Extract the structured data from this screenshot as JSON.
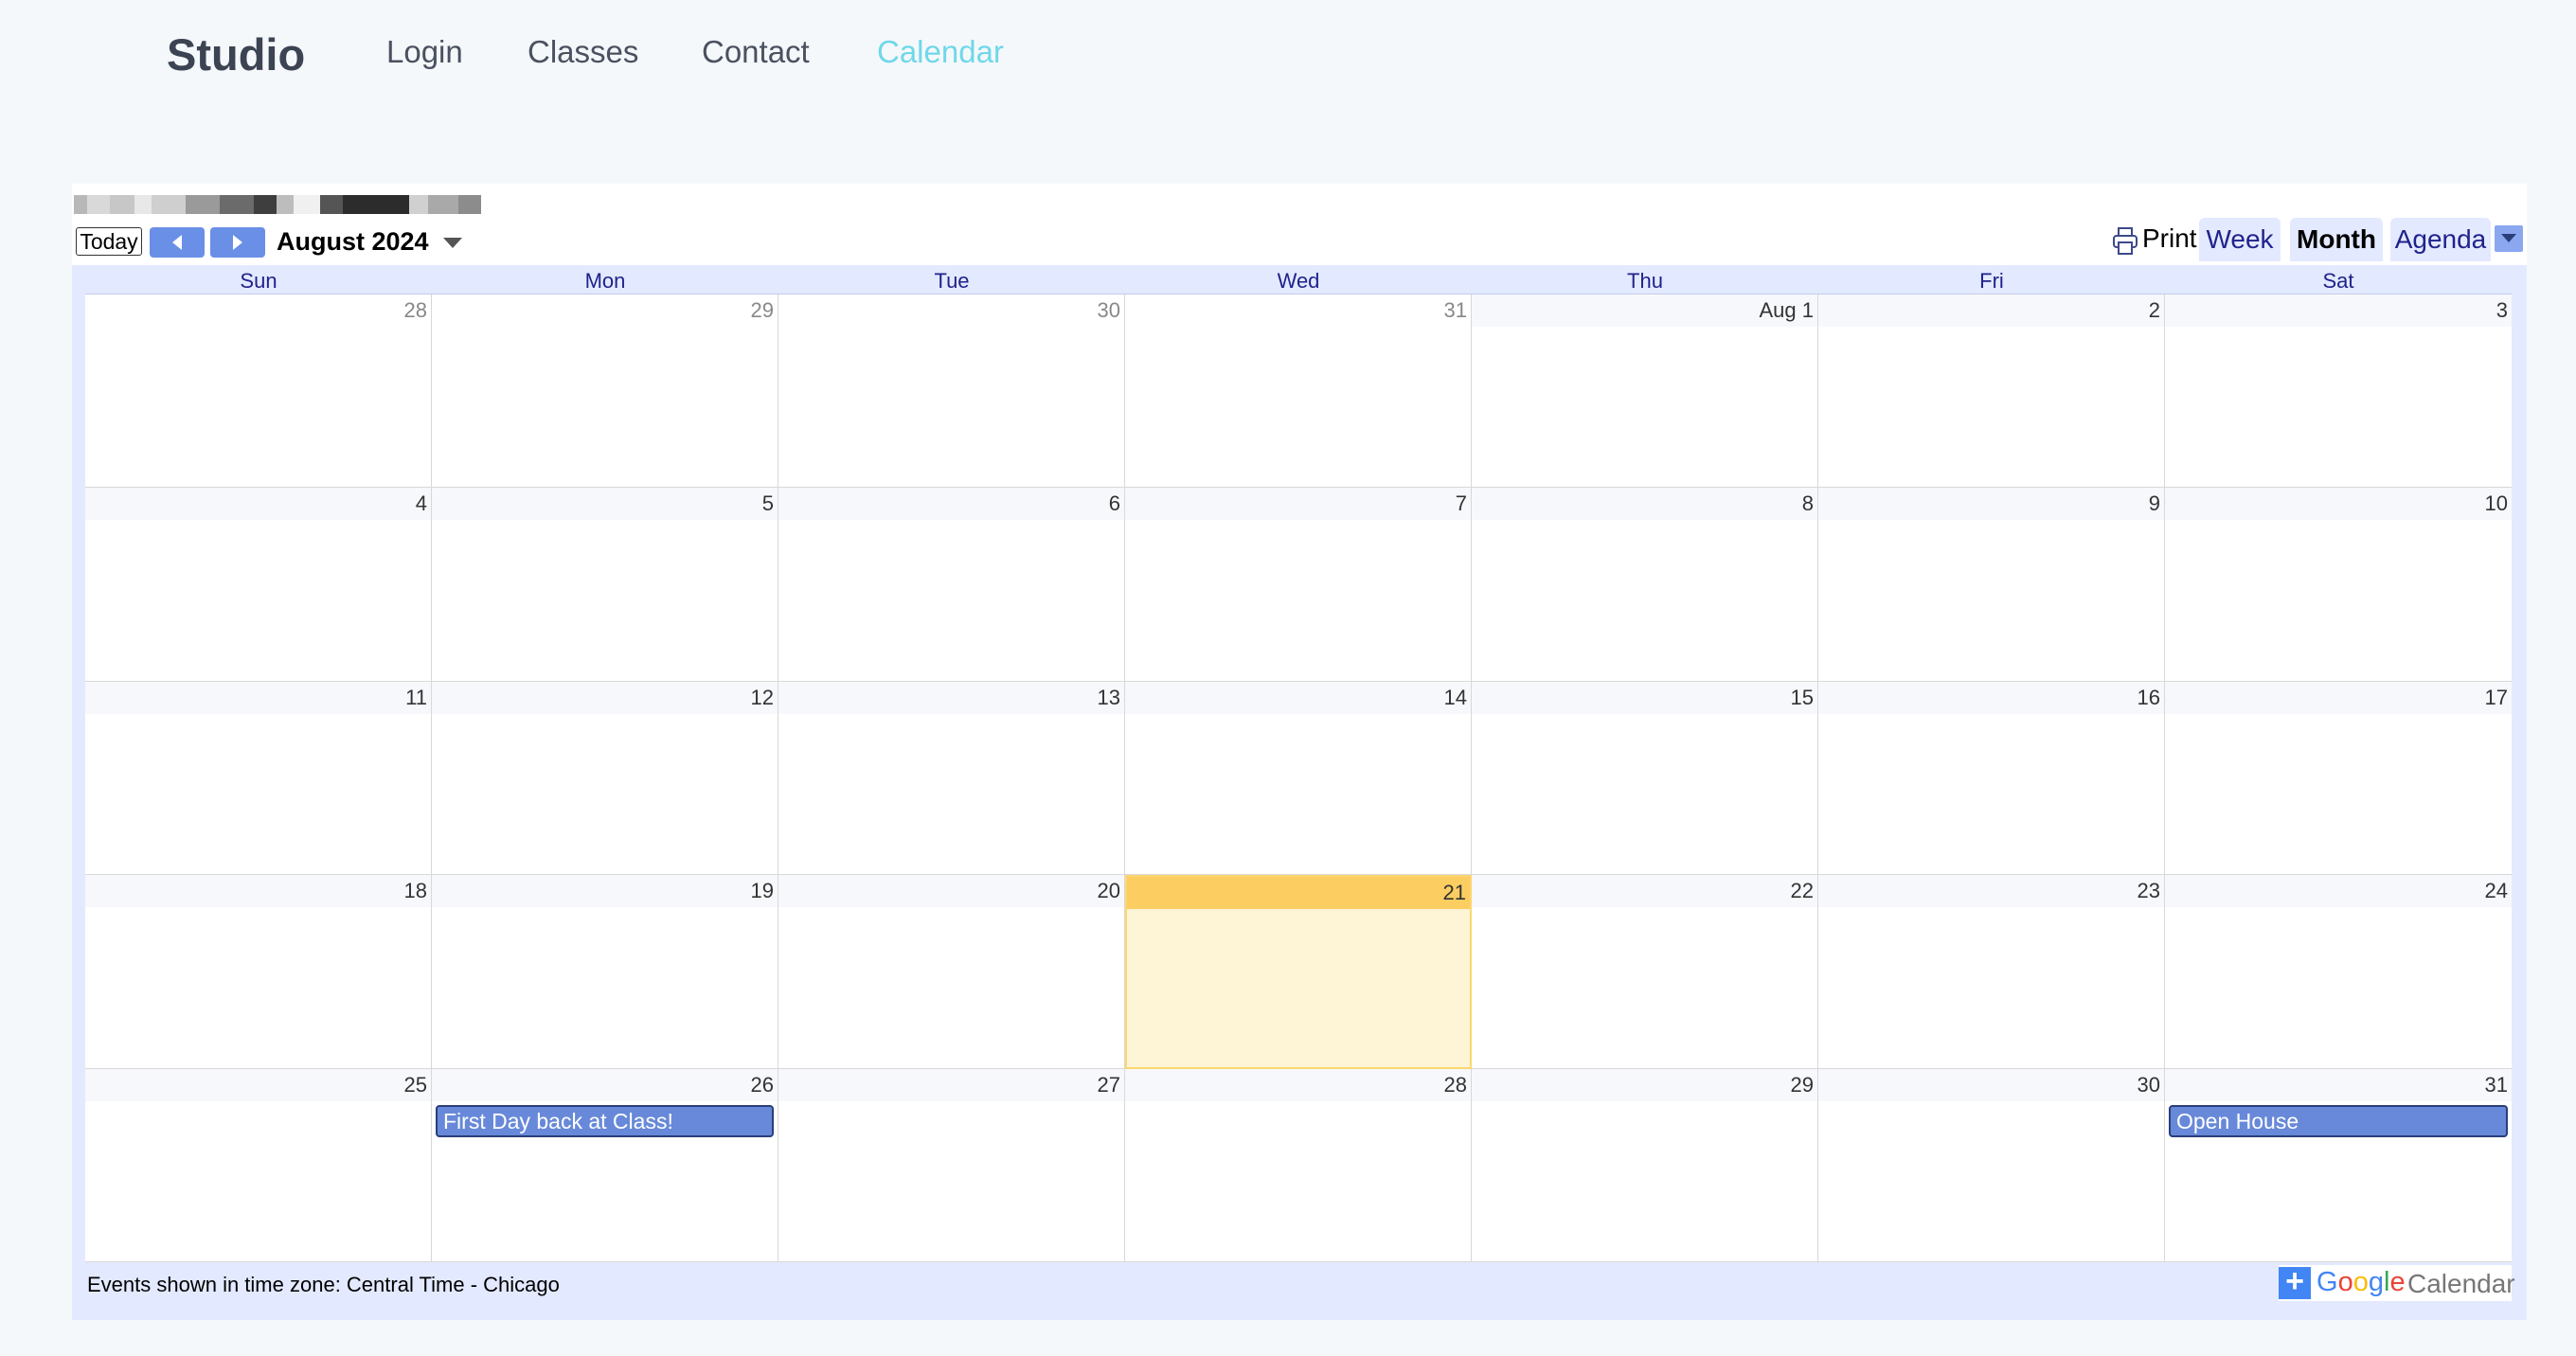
{
  "nav": {
    "brand": "Studio",
    "links": [
      "Login",
      "Classes",
      "Contact",
      "Calendar"
    ],
    "active": "Calendar",
    "active_color": "#6fd8ea"
  },
  "calendar": {
    "today_label": "Today",
    "month_label": "August 2024",
    "print_label": "Print",
    "views": [
      "Week",
      "Month",
      "Agenda"
    ],
    "active_view": "Month",
    "weekdays": [
      "Sun",
      "Mon",
      "Tue",
      "Wed",
      "Thu",
      "Fri",
      "Sat"
    ],
    "weeks": [
      [
        {
          "label": "28",
          "other": true
        },
        {
          "label": "29",
          "other": true
        },
        {
          "label": "30",
          "other": true
        },
        {
          "label": "31",
          "other": true
        },
        {
          "label": "Aug 1"
        },
        {
          "label": "2"
        },
        {
          "label": "3"
        }
      ],
      [
        {
          "label": "4"
        },
        {
          "label": "5"
        },
        {
          "label": "6"
        },
        {
          "label": "7"
        },
        {
          "label": "8"
        },
        {
          "label": "9"
        },
        {
          "label": "10"
        }
      ],
      [
        {
          "label": "11"
        },
        {
          "label": "12"
        },
        {
          "label": "13"
        },
        {
          "label": "14"
        },
        {
          "label": "15"
        },
        {
          "label": "16"
        },
        {
          "label": "17"
        }
      ],
      [
        {
          "label": "18"
        },
        {
          "label": "19"
        },
        {
          "label": "20"
        },
        {
          "label": "21",
          "today": true
        },
        {
          "label": "22"
        },
        {
          "label": "23"
        },
        {
          "label": "24"
        }
      ],
      [
        {
          "label": "25"
        },
        {
          "label": "26",
          "event": "First Day back at Class!"
        },
        {
          "label": "27"
        },
        {
          "label": "28"
        },
        {
          "label": "29"
        },
        {
          "label": "30"
        },
        {
          "label": "31",
          "event": "Open House"
        }
      ]
    ],
    "timezone_note": "Events shown in time zone: Central Time - Chicago",
    "badge": {
      "google_letters": [
        "G",
        "o",
        "o",
        "g",
        "l",
        "e"
      ],
      "word": "Calendar"
    },
    "colors": {
      "event": "#6889d9",
      "today_header": "#fccd61",
      "today_body": "#fdf5d5",
      "frame": "#e3e9ff"
    }
  }
}
